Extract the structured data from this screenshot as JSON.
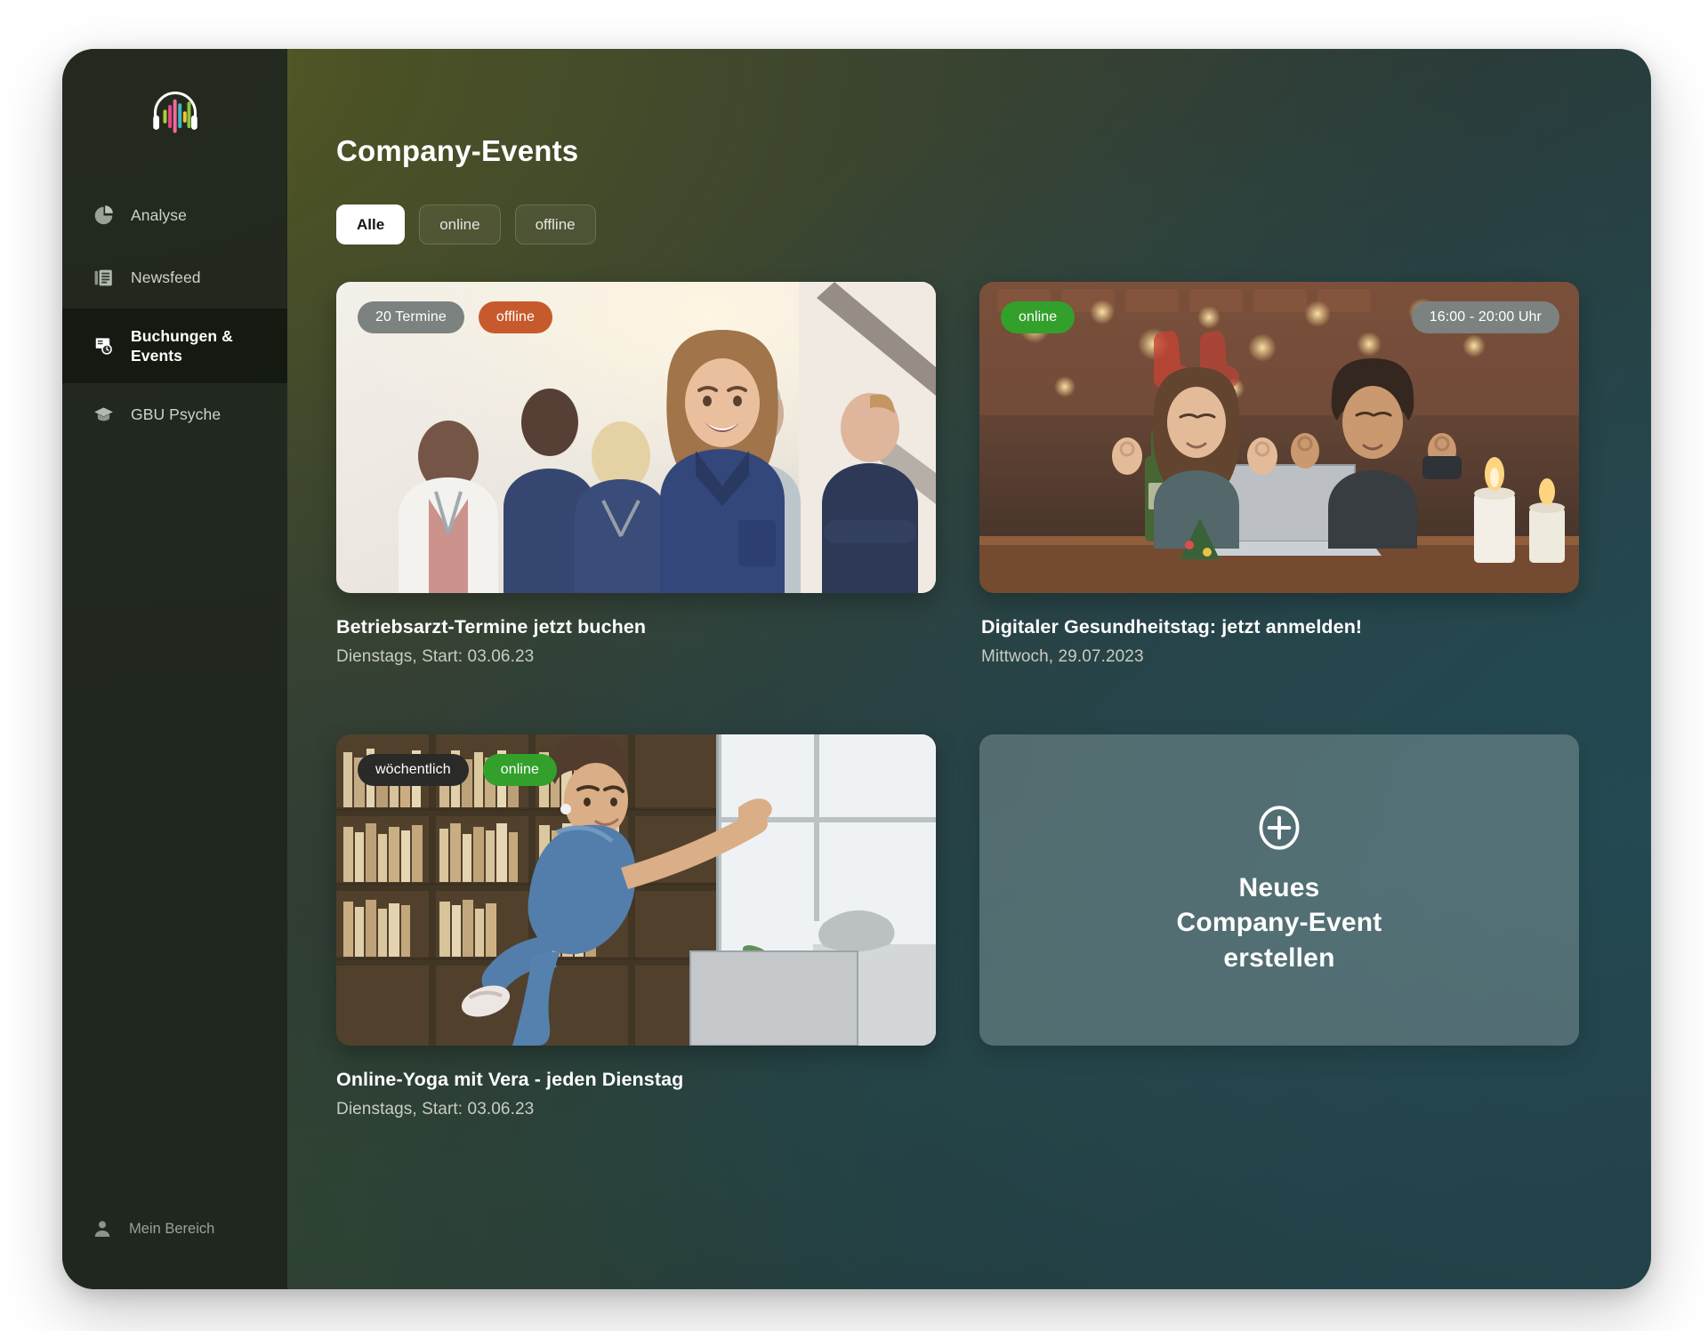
{
  "app": {
    "logo_icon": "headphones-waveform-logo"
  },
  "sidebar": {
    "items": [
      {
        "label": "Analyse",
        "icon": "pie-chart-icon",
        "active": false
      },
      {
        "label": "Newsfeed",
        "icon": "newspaper-icon",
        "active": false
      },
      {
        "label": "Buchungen & Events",
        "icon": "calendar-clock-icon",
        "active": true
      },
      {
        "label": "GBU Psyche",
        "icon": "graduation-cap-icon",
        "active": false
      }
    ],
    "bottom": {
      "label": "Mein Bereich",
      "icon": "user-icon"
    }
  },
  "main": {
    "title": "Company-Events",
    "filters": [
      {
        "label": "Alle",
        "selected": true
      },
      {
        "label": "online",
        "selected": false
      },
      {
        "label": "offline",
        "selected": false
      }
    ],
    "cards": [
      {
        "title": "Betriebsarzt-Termine jetzt buchen",
        "subtitle": "Dienstags, Start: 03.06.23",
        "image_alt": "medical-team-photo",
        "badges": [
          {
            "label": "20 Termine",
            "style": "grey"
          },
          {
            "label": "offline",
            "style": "orange"
          }
        ],
        "badge_right": null
      },
      {
        "title": "Digitaler Gesundheitstag: jetzt anmelden!",
        "subtitle": "Mittwoch, 29.07.2023",
        "image_alt": "online-meditation-couple-photo",
        "badges": [
          {
            "label": "online",
            "style": "green"
          }
        ],
        "badge_right": {
          "label": "16:00 - 20:00 Uhr",
          "style": "grey"
        }
      },
      {
        "title": "Online-Yoga mit Vera - jeden Dienstag",
        "subtitle": "Dienstags, Start: 03.06.23",
        "image_alt": "woman-yoga-laptop-photo",
        "badges": [
          {
            "label": "wöchentlich",
            "style": "dark"
          },
          {
            "label": "online",
            "style": "green"
          }
        ],
        "badge_right": null
      }
    ],
    "create_card": {
      "icon": "plus-circle-icon",
      "label": "Neues\nCompany-Event\nerstellen"
    }
  },
  "colors": {
    "badge_grey": "#7c8280",
    "badge_orange": "#c75a2c",
    "badge_green": "#33a02c",
    "badge_dark": "#2a2a28",
    "sidebar_bg": "#1f261e",
    "accent_white": "#ffffff",
    "bg_olive": "#4b5126",
    "bg_teal": "#24403f"
  }
}
